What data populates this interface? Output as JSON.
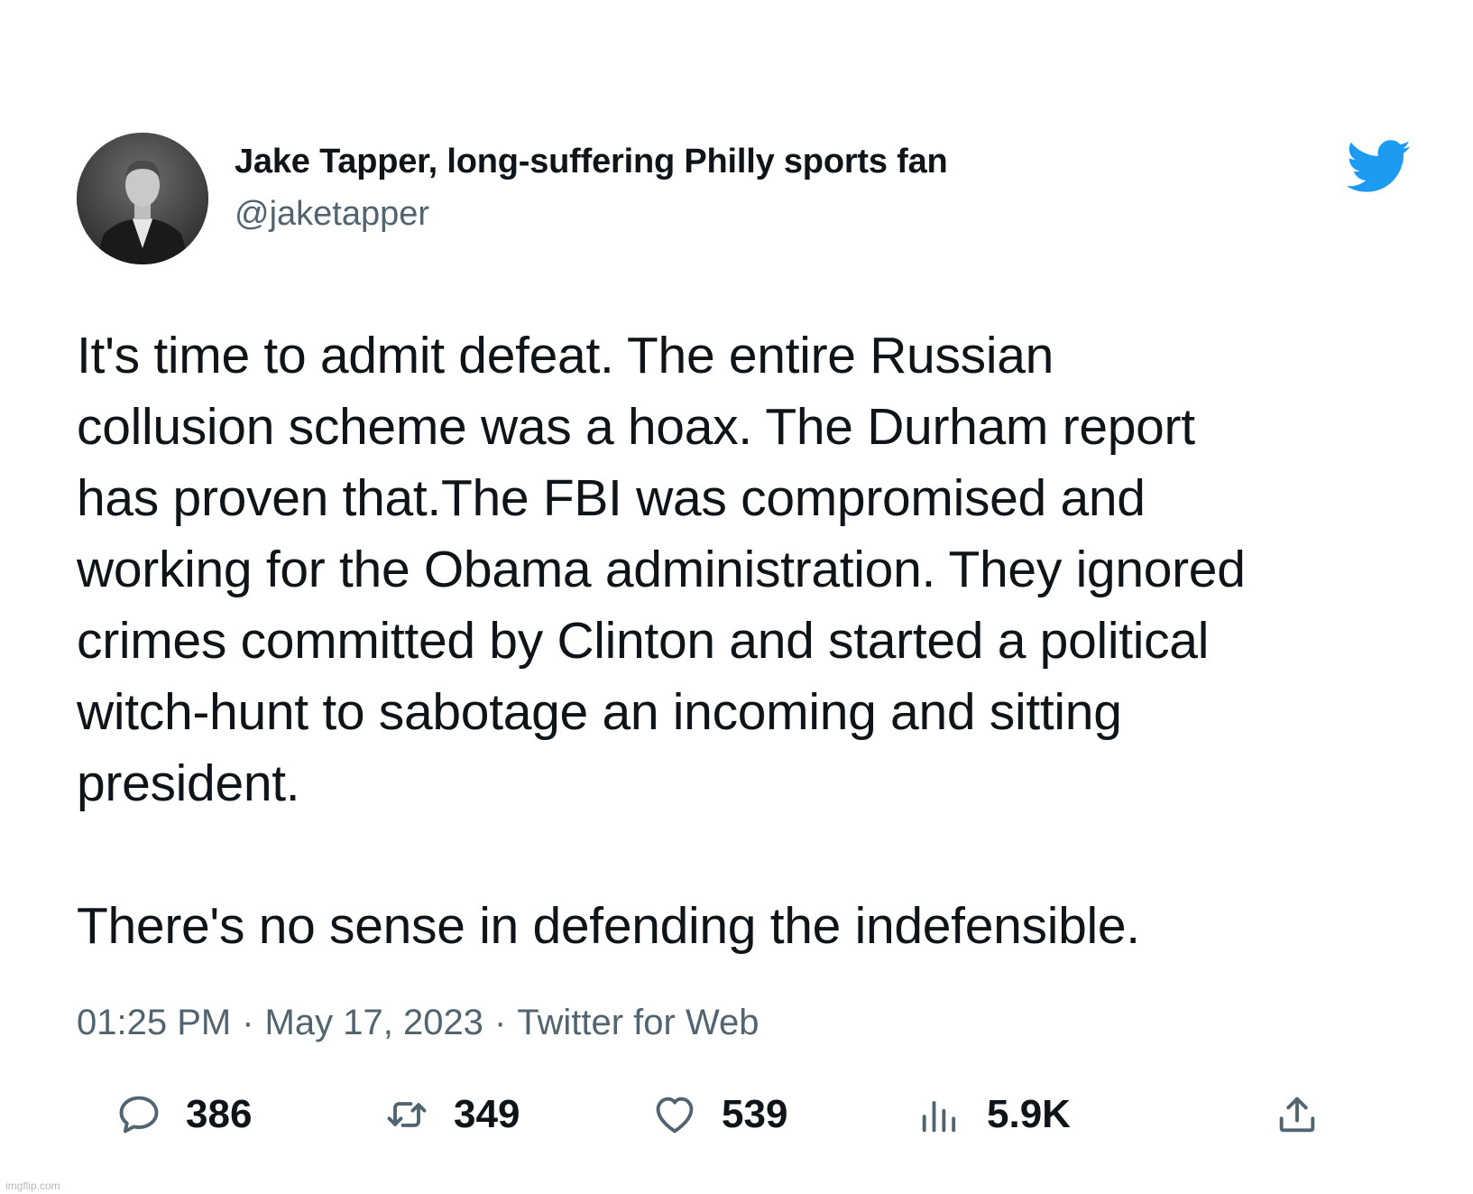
{
  "user": {
    "display_name": "Jake Tapper, long-suffering Philly sports fan",
    "handle": "@jaketapper"
  },
  "tweet": {
    "text": "It's time to admit defeat. The entire Russian\ncollusion scheme was a hoax. The Durham report\nhas proven that.The FBI was compromised and\nworking for the Obama administration. They ignored\ncrimes committed by Clinton and started a political\nwitch-hunt to sabotage an incoming and sitting\npresident.\n\nThere's no sense in defending the indefensible.",
    "time": "01:25 PM",
    "date": "May 17, 2023",
    "source": "Twitter for Web",
    "separator": "·"
  },
  "actions": {
    "replies": "386",
    "retweets": "349",
    "likes": "539",
    "views": "5.9K"
  },
  "icons": {
    "brand": "twitter-bird-icon",
    "reply": "reply-icon",
    "retweet": "retweet-icon",
    "like": "heart-icon",
    "views": "views-icon",
    "share": "share-icon"
  },
  "colors": {
    "brand": "#1d9bf0",
    "text": "#0f1419",
    "muted": "#536471"
  },
  "watermark": "imgflip.com"
}
